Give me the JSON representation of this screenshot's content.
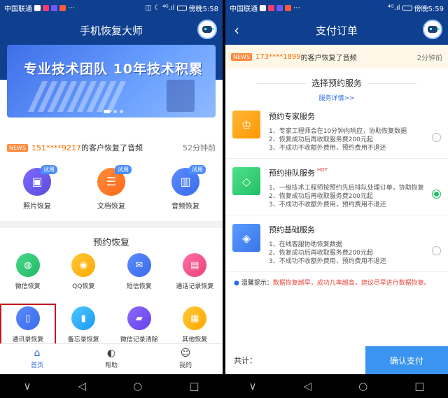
{
  "status_left": {
    "carrier": "中国联通",
    "time": "傍晚5:58",
    "time_prefix_icons": "◫ ☾ ",
    "signal": "⁴ᴳ.ıl"
  },
  "status_right": {
    "carrier": "中国联通",
    "time": "傍晚5:59",
    "signal": "⁴ᴳ.ıl"
  },
  "home": {
    "title": "手机恢复大师",
    "banner_text": "专业技术团队 10年技术积累",
    "ticker": {
      "badge": "NEWS",
      "phone": "151****9217",
      "text": "的客户恢复了音频",
      "time": "52分钟前"
    },
    "try_badge": "试用",
    "try_items": [
      {
        "label": "照片恢复",
        "icon": "image-icon",
        "glyph": "▣",
        "color": "c-purple"
      },
      {
        "label": "文档恢复",
        "icon": "document-icon",
        "glyph": "☰",
        "color": "c-orange"
      },
      {
        "label": "音频恢复",
        "icon": "audio-icon",
        "glyph": "▥",
        "color": "c-blue"
      }
    ],
    "section_title": "预约恢复",
    "grid": [
      {
        "label": "微信恢复",
        "icon": "wechat-icon",
        "glyph": "◍",
        "color": "c-green"
      },
      {
        "label": "QQ恢复",
        "icon": "qq-icon",
        "glyph": "◉",
        "color": "c-yellow"
      },
      {
        "label": "短信恢复",
        "icon": "mail-icon",
        "glyph": "✉",
        "color": "c-blue"
      },
      {
        "label": "通话记录恢复",
        "icon": "call-log-icon",
        "glyph": "▤",
        "color": "c-pink"
      },
      {
        "label": "通讯录恢复",
        "icon": "contacts-icon",
        "glyph": "▯",
        "color": "c-blue"
      },
      {
        "label": "备忘录恢复",
        "icon": "memo-icon",
        "glyph": "▮",
        "color": "c-sky"
      },
      {
        "label": "微信记录清除",
        "icon": "wechat-clear-icon",
        "glyph": "▰",
        "color": "c-violet"
      },
      {
        "label": "其他恢复",
        "icon": "grid-icon",
        "glyph": "▦",
        "color": "c-yellow"
      }
    ],
    "tabs": [
      {
        "label": "首页",
        "icon": "home-icon",
        "glyph": "⌂"
      },
      {
        "label": "帮助",
        "icon": "help-icon",
        "glyph": "◐"
      },
      {
        "label": "我的",
        "icon": "user-icon",
        "glyph": "☺"
      }
    ]
  },
  "order": {
    "title": "支付订单",
    "back_glyph": "‹",
    "ticker": {
      "badge": "NEWS",
      "phone": "173****1899",
      "text": "的客户恢复了音频",
      "time": "2分钟前"
    },
    "heading": "选择预约服务",
    "details_link": "服务详情>>",
    "services": [
      {
        "name": "预约专家服务",
        "hot": "",
        "icon": "crown-icon",
        "glyph": "♔",
        "color": "sq-orange",
        "lines": [
          "1、专家工程师会在10分钟内响应，协助恢复数据",
          "2、恢复成功后再收取服务费200元起",
          "3、不成功不收额外费用，预约费用不退还"
        ],
        "selected": false
      },
      {
        "name": "预约排队服务",
        "hot": "HOT",
        "icon": "diamond-icon",
        "glyph": "◇",
        "color": "sq-green",
        "lines": [
          "1、一级技术工程师按预约先后排队处理订单，协助恢复",
          "2、恢复成功后再收取服务费200元起",
          "3、不成功不收额外费用，预约费用不退还"
        ],
        "selected": true
      },
      {
        "name": "预约基础服务",
        "hot": "",
        "icon": "layers-icon",
        "glyph": "◈",
        "color": "sq-blue",
        "lines": [
          "1、在线客服协助恢复数据",
          "2、恢复成功后再收取服务费200元起",
          "3、不成功不收额外费用，预约费用不退还"
        ],
        "selected": false
      }
    ],
    "tip_label": "温馨提示：",
    "tip_text": "数据恢复越早，成功几率越高，建议尽早进行数据恢复。",
    "total_label": "共计：",
    "pay_button": "确认支付"
  },
  "nav_glyphs": [
    "∨",
    "◁",
    "○",
    "□"
  ]
}
